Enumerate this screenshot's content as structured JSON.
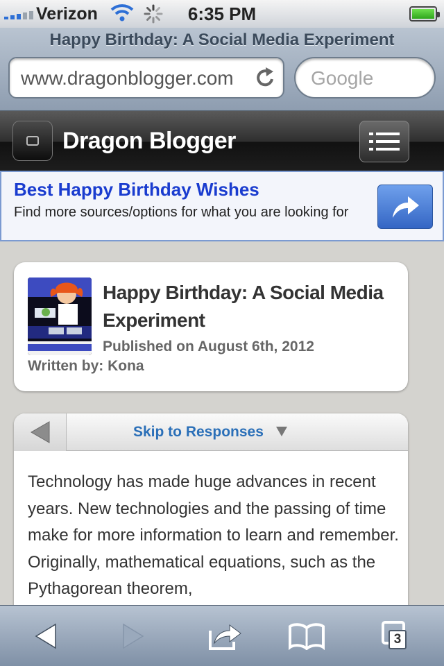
{
  "status_bar": {
    "carrier": "Verizon",
    "time": "6:35 PM",
    "battery_level": 1.0,
    "icons": [
      "signal-icon",
      "wifi-icon",
      "activity-spinner-icon",
      "battery-icon"
    ]
  },
  "browser": {
    "page_title": "Happy Birthday: A Social Media Experiment",
    "url": "www.dragonblogger.com",
    "search_placeholder": "Google"
  },
  "site": {
    "name": "Dragon Blogger"
  },
  "ad": {
    "title": "Best Happy Birthday Wishes",
    "description": "Find more sources/options for what you are looking for"
  },
  "post": {
    "title": "Happy Birthday: A Social Media Experiment",
    "published": "Published on August 6th, 2012",
    "author": "Written by: Kona"
  },
  "content": {
    "skip_label": "Skip to Responses",
    "body": "Technology has made huge advances in recent years. New technologies and the passing of time make for more information to learn and remember. Originally, mathematical equations, such as the Pythagorean theorem,"
  },
  "toolbar": {
    "tab_count": "3"
  },
  "colors": {
    "link_blue": "#2a6fb8",
    "ad_title_blue": "#1a3ccf",
    "battery_green": "#4fd03a",
    "toolbar_blue": "#8e9db0"
  }
}
